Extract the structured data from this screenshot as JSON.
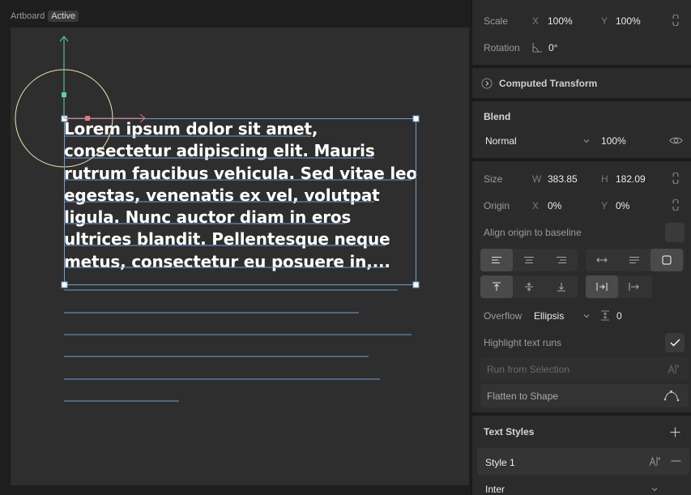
{
  "canvas": {
    "artboard_label": "Artboard",
    "artboard_badge": "Active",
    "text_lines": [
      "Lorem ipsum dolor sit amet,",
      "consectetur adipiscing elit. Mauris",
      "rutrum faucibus vehicula. Sed vitae leo",
      "egestas, venenatis ex vel, volutpat",
      "ligula. Nunc auctor diam in eros",
      "ultrices blandit. Pellentesque neque",
      "metus, consectetur eu posuere in,..."
    ],
    "colors": {
      "selection": "#6f9fd8",
      "axis_y": "#5fd3a3",
      "axis_x": "#e07a7a",
      "circle": "#efe3b0"
    }
  },
  "panel": {
    "scale": {
      "label": "Scale",
      "x_axis": "X",
      "x_value": "100%",
      "y_axis": "Y",
      "y_value": "100%"
    },
    "rotation": {
      "label": "Rotation",
      "value": "0°"
    },
    "computed_transform": {
      "label": "Computed Transform"
    },
    "blend": {
      "title": "Blend",
      "mode": "Normal",
      "opacity": "100%"
    },
    "size": {
      "label": "Size",
      "w_axis": "W",
      "w_value": "383.85",
      "h_axis": "H",
      "h_value": "182.09"
    },
    "origin": {
      "label": "Origin",
      "x_axis": "X",
      "x_value": "0%",
      "y_axis": "Y",
      "y_value": "0%"
    },
    "align_origin": {
      "label": "Align origin to baseline"
    },
    "overflow": {
      "label": "Overflow",
      "value": "Ellipsis",
      "paragraph_spacing": "0"
    },
    "highlight_text_runs": {
      "label": "Highlight text runs"
    },
    "run_from_selection": {
      "label": "Run from Selection"
    },
    "flatten_to_shape": {
      "label": "Flatten to Shape"
    },
    "text_styles": {
      "title": "Text Styles",
      "style_name": "Style 1",
      "font": "Inter"
    }
  }
}
